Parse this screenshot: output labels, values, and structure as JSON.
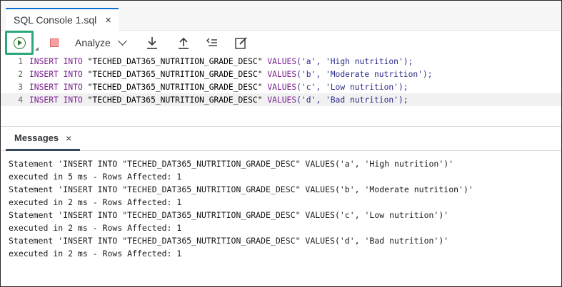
{
  "tab": {
    "label": "SQL Console 1.sql",
    "close": "×"
  },
  "toolbar": {
    "run_icon": "run-icon",
    "stop_icon": "stop-icon",
    "analyze_label": "Analyze",
    "download_icon": "download-icon",
    "upload_icon": "upload-icon",
    "format_icon": "format-icon",
    "edit_icon": "edit-icon"
  },
  "editor": {
    "lines": [
      {
        "num": "1",
        "kw1": "INSERT",
        "kw2": "INTO",
        "table": "\"TECHED_DAT365_NUTRITION_GRADE_DESC\"",
        "kw3": "VALUES",
        "args": "('a', 'High nutrition');"
      },
      {
        "num": "2",
        "kw1": "INSERT",
        "kw2": "INTO",
        "table": "\"TECHED_DAT365_NUTRITION_GRADE_DESC\"",
        "kw3": "VALUES",
        "args": "('b', 'Moderate nutrition');"
      },
      {
        "num": "3",
        "kw1": "INSERT",
        "kw2": "INTO",
        "table": "\"TECHED_DAT365_NUTRITION_GRADE_DESC\"",
        "kw3": "VALUES",
        "args": "('c', 'Low nutrition');"
      },
      {
        "num": "4",
        "kw1": "INSERT",
        "kw2": "INTO",
        "table": "\"TECHED_DAT365_NUTRITION_GRADE_DESC\"",
        "kw3": "VALUES",
        "args": "('d', 'Bad nutrition');"
      }
    ]
  },
  "messages_tab": {
    "label": "Messages",
    "close": "×"
  },
  "messages": [
    "Statement 'INSERT INTO \"TECHED_DAT365_NUTRITION_GRADE_DESC\" VALUES('a', 'High nutrition')'",
    "executed in 5 ms - Rows Affected: 1",
    "Statement 'INSERT INTO \"TECHED_DAT365_NUTRITION_GRADE_DESC\" VALUES('b', 'Moderate nutrition')'",
    "executed in 2 ms - Rows Affected: 1",
    "Statement 'INSERT INTO \"TECHED_DAT365_NUTRITION_GRADE_DESC\" VALUES('c', 'Low nutrition')'",
    "executed in 2 ms - Rows Affected: 1",
    "Statement 'INSERT INTO \"TECHED_DAT365_NUTRITION_GRADE_DESC\" VALUES('d', 'Bad nutrition')'",
    "executed in 2 ms - Rows Affected: 1"
  ],
  "colors": {
    "accent": "#0a6ed1",
    "run_highlight": "#2aa876",
    "keyword": "#7a1f8f"
  }
}
